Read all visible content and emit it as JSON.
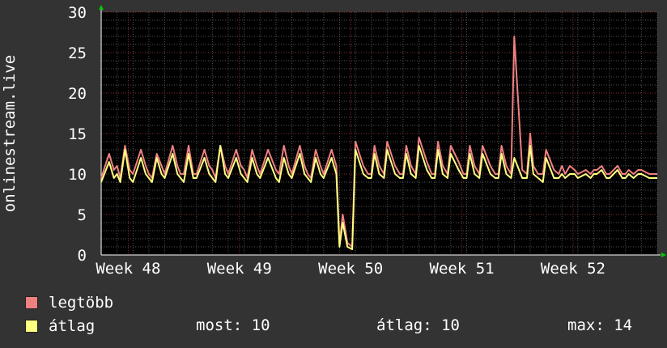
{
  "chart_data": {
    "type": "line",
    "ylabel": "onlinestream.live",
    "ylim": [
      0,
      30
    ],
    "yticks": [
      0,
      5,
      10,
      15,
      20,
      25,
      30
    ],
    "xtick_labels": [
      "Week 48",
      "Week 49",
      "Week 50",
      "Week 51",
      "Week 52"
    ],
    "grid": true,
    "x_range_days": [
      0,
      35
    ],
    "series": [
      {
        "name": "legtöbb",
        "color": "#f08080",
        "x_day": [
          0,
          0.5,
          0.8,
          1.0,
          1.2,
          1.5,
          1.8,
          2.0,
          2.5,
          2.8,
          3.0,
          3.2,
          3.5,
          3.8,
          4.0,
          4.5,
          4.8,
          5.0,
          5.2,
          5.5,
          5.8,
          6.0,
          6.5,
          6.8,
          7.0,
          7.2,
          7.5,
          7.8,
          8.0,
          8.5,
          8.8,
          9.0,
          9.2,
          9.5,
          9.8,
          10.0,
          10.5,
          10.8,
          11.0,
          11.2,
          11.5,
          11.8,
          12.0,
          12.5,
          12.8,
          13.0,
          13.2,
          13.5,
          13.8,
          14.0,
          14.5,
          14.8,
          15.0,
          15.2,
          15.5,
          15.8,
          16.0,
          16.5,
          16.8,
          17.0,
          17.2,
          17.5,
          17.8,
          18.0,
          18.5,
          18.8,
          19.0,
          19.2,
          19.5,
          19.8,
          20.0,
          20.5,
          20.8,
          21.0,
          21.2,
          21.5,
          21.8,
          22.0,
          22.5,
          22.8,
          23.0,
          23.2,
          23.5,
          23.8,
          24.0,
          24.5,
          24.8,
          25.0,
          25.2,
          25.5,
          25.8,
          26.0,
          26.5,
          26.8,
          27.0,
          27.2,
          27.5,
          27.8,
          28.0,
          28.5,
          28.8,
          29.0,
          29.2,
          29.5,
          29.8,
          30.0,
          30.5,
          30.8,
          31.0,
          31.2,
          31.5,
          31.8,
          32.0,
          32.5,
          32.8,
          33.0,
          33.2,
          33.5,
          33.8,
          34.0,
          34.5,
          35.0
        ],
        "values": [
          9.5,
          12.5,
          10.5,
          11,
          9.5,
          13.5,
          10.5,
          10,
          13,
          11,
          10,
          9.5,
          12.5,
          11,
          10,
          13.5,
          11,
          10,
          10,
          13.5,
          10,
          10,
          13,
          11,
          10.5,
          9.5,
          13.5,
          11,
          10,
          13,
          11,
          10.5,
          9.5,
          13,
          11,
          10,
          13,
          11.5,
          10.5,
          10,
          13.5,
          11,
          10,
          13.5,
          11,
          10,
          9.5,
          13,
          11,
          10,
          13,
          11,
          1.5,
          5,
          1.5,
          1,
          14,
          11,
          10,
          10,
          13.5,
          11,
          10,
          14,
          11,
          10,
          10,
          13.5,
          11,
          10,
          14.5,
          11.5,
          10,
          10,
          14,
          11,
          10,
          13.5,
          11.5,
          10,
          10,
          13.5,
          11,
          10,
          13.5,
          11,
          10,
          10,
          13.5,
          11,
          10,
          27,
          10.5,
          10,
          15,
          11,
          10,
          10,
          13,
          10.5,
          10,
          11,
          10,
          11,
          10.5,
          10,
          10.5,
          10,
          10.5,
          10.5,
          11,
          10,
          10,
          11,
          10,
          10,
          10.5,
          10,
          10.5,
          10.5,
          10,
          10,
          10.5,
          10.5
        ],
        "range_note": "maxima series"
      },
      {
        "name": "átlag",
        "color": "#ffff80",
        "x_day": [
          0,
          0.5,
          0.8,
          1.0,
          1.2,
          1.5,
          1.8,
          2.0,
          2.5,
          2.8,
          3.0,
          3.2,
          3.5,
          3.8,
          4.0,
          4.5,
          4.8,
          5.0,
          5.2,
          5.5,
          5.8,
          6.0,
          6.5,
          6.8,
          7.0,
          7.2,
          7.5,
          7.8,
          8.0,
          8.5,
          8.8,
          9.0,
          9.2,
          9.5,
          9.8,
          10.0,
          10.5,
          10.8,
          11.0,
          11.2,
          11.5,
          11.8,
          12.0,
          12.5,
          12.8,
          13.0,
          13.2,
          13.5,
          13.8,
          14.0,
          14.5,
          14.8,
          15.0,
          15.2,
          15.5,
          15.8,
          16.0,
          16.5,
          16.8,
          17.0,
          17.2,
          17.5,
          17.8,
          18.0,
          18.5,
          18.8,
          19.0,
          19.2,
          19.5,
          19.8,
          20.0,
          20.5,
          20.8,
          21.0,
          21.2,
          21.5,
          21.8,
          22.0,
          22.5,
          22.8,
          23.0,
          23.2,
          23.5,
          23.8,
          24.0,
          24.5,
          24.8,
          25.0,
          25.2,
          25.5,
          25.8,
          26.0,
          26.5,
          26.8,
          27.0,
          27.2,
          27.5,
          27.8,
          28.0,
          28.5,
          28.8,
          29.0,
          29.2,
          29.5,
          29.8,
          30.0,
          30.5,
          30.8,
          31.0,
          31.2,
          31.5,
          31.8,
          32.0,
          32.5,
          32.8,
          33.0,
          33.2,
          33.5,
          33.8,
          34.0,
          34.5,
          35.0
        ],
        "values": [
          9,
          11.5,
          9.5,
          10,
          9,
          13,
          9.5,
          9,
          12,
          10,
          9.5,
          9,
          12,
          10,
          9.5,
          12.5,
          10,
          9.5,
          9,
          12.5,
          9.5,
          9.5,
          12,
          10,
          9.5,
          9,
          13.5,
          10,
          9.5,
          12,
          10,
          9.5,
          9,
          12,
          10,
          9.5,
          12,
          10.5,
          9.5,
          9,
          12,
          10,
          9.5,
          12.5,
          10,
          9.5,
          9,
          12,
          10,
          9.5,
          12,
          10,
          1,
          4,
          1,
          0.7,
          13,
          10,
          9.5,
          9.5,
          12.5,
          10,
          9.5,
          13,
          10,
          9.5,
          9.5,
          12.5,
          10,
          9.5,
          13.5,
          10.5,
          9.5,
          9.5,
          13,
          10,
          9.5,
          12.5,
          10.5,
          9.5,
          9.5,
          12.5,
          10,
          9.5,
          12.5,
          10,
          9.5,
          9.5,
          12.5,
          10,
          9.5,
          12,
          9.5,
          9.5,
          13.5,
          10,
          9.5,
          9,
          12,
          9.5,
          9.5,
          10,
          9.5,
          10,
          10,
          9.5,
          10,
          9.5,
          10,
          10,
          10.5,
          9.5,
          9.5,
          10.5,
          9.5,
          9.5,
          10,
          9.5,
          10,
          10,
          9.5,
          9.5,
          10,
          10
        ]
      }
    ],
    "legend_placement": "bottom-left"
  },
  "legend": {
    "items": [
      {
        "label": "legtöbb",
        "color": "#f08080"
      },
      {
        "label": "átlag",
        "color": "#ffff80"
      }
    ]
  },
  "stats": {
    "most": "most: 10",
    "avg": "átlag: 10",
    "max": "max: 14"
  },
  "colors": {
    "background": "#333333",
    "plot_bg": "#000000",
    "grid_major": "#8a3030",
    "grid_minor": "#555555",
    "axis_arrow": "#00cc00",
    "text": "#ffffff"
  }
}
